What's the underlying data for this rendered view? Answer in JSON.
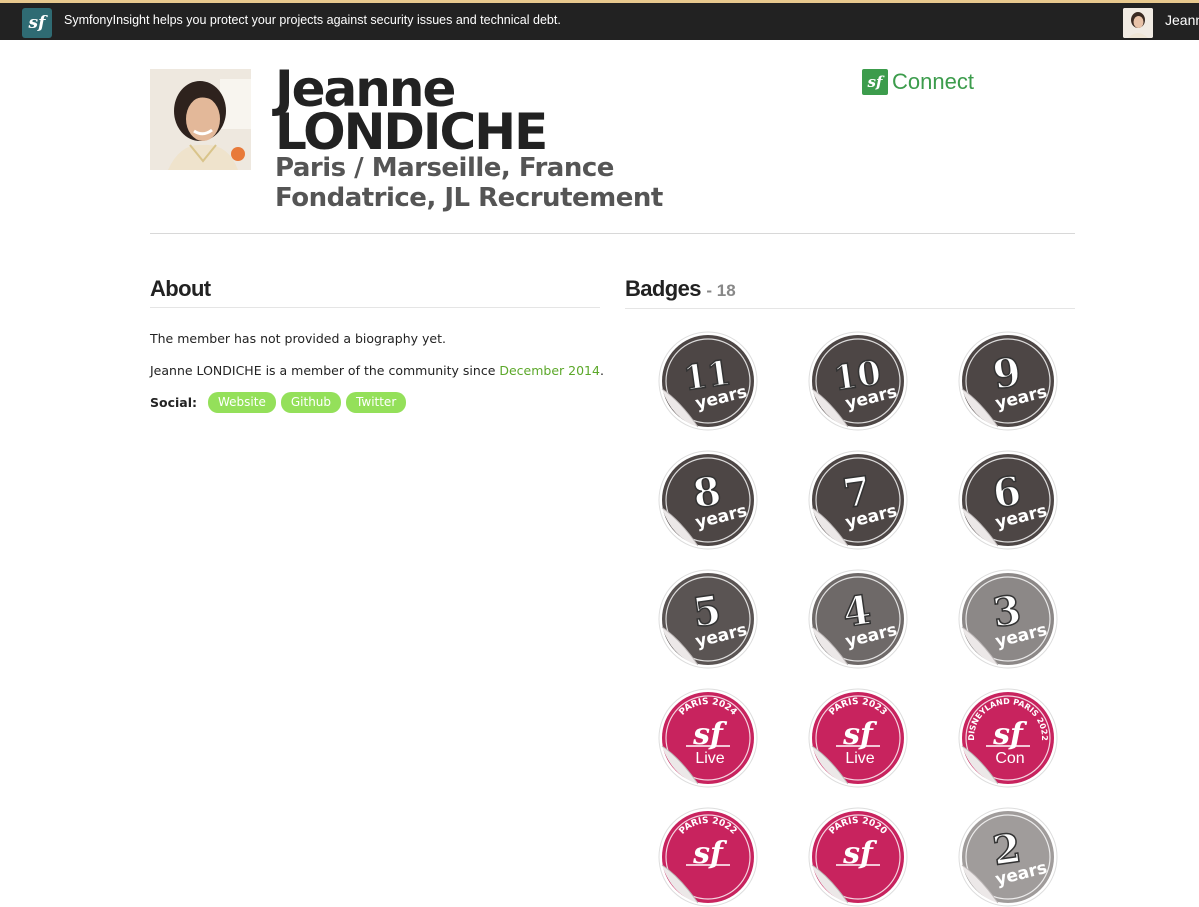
{
  "topbar": {
    "promo": "SymfonyInsight helps you protect your projects against security issues and technical debt.",
    "user_name": "Jeann",
    "logo_text": "sf",
    "brand_color": "#2f6b73"
  },
  "profile": {
    "first_name": "Jeanne",
    "last_name": "LONDICHE",
    "location": "Paris / Marseille, France",
    "position": "Fondatrice, JL Recrutement"
  },
  "connect": {
    "logo_text": "sf",
    "label": "Connect",
    "color": "#3c9c4c"
  },
  "about": {
    "title": "About",
    "bio": "The member has not provided a biography yet.",
    "member_prefix": "Jeanne LONDICHE is a member of the community since ",
    "member_since": "December 2014",
    "member_suffix": ".",
    "social_label": "Social:",
    "social_links": [
      "Website",
      "Github",
      "Twitter"
    ],
    "link_color": "#5ca82a",
    "pill_color": "#94e05a"
  },
  "badges": {
    "title": "Badges",
    "count": "- 18",
    "years_word": "years",
    "items": [
      {
        "kind": "years",
        "number": "11",
        "color": "#4d4645"
      },
      {
        "kind": "years",
        "number": "10",
        "color": "#4d4645"
      },
      {
        "kind": "years",
        "number": "9",
        "color": "#4d4645"
      },
      {
        "kind": "years",
        "number": "8",
        "color": "#4d4645"
      },
      {
        "kind": "years",
        "number": "7",
        "color": "#4d4645"
      },
      {
        "kind": "years",
        "number": "6",
        "color": "#4d4645"
      },
      {
        "kind": "years",
        "number": "5",
        "color": "#5a5453"
      },
      {
        "kind": "years",
        "number": "4",
        "color": "#6e6968"
      },
      {
        "kind": "years",
        "number": "3",
        "color": "#8c8887"
      },
      {
        "kind": "event",
        "ring": "PARIS 2024",
        "word": "Live",
        "color": "#c8235e"
      },
      {
        "kind": "event",
        "ring": "PARIS 2023",
        "word": "Live",
        "color": "#c8235e"
      },
      {
        "kind": "event",
        "ring": "DISNEYLAND PARIS 2022",
        "word": "Con",
        "color": "#c8235e"
      },
      {
        "kind": "event",
        "ring": "PARIS 2022",
        "word": "",
        "color": "#c8235e"
      },
      {
        "kind": "event",
        "ring": "PARIS 2020",
        "word": "",
        "color": "#c8235e"
      },
      {
        "kind": "years",
        "number": "2",
        "color": "#a09c9b"
      }
    ]
  }
}
